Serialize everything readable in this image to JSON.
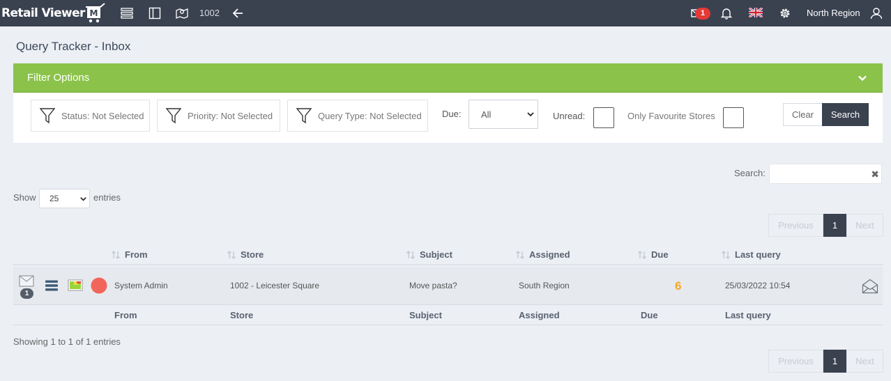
{
  "topbar": {
    "brand": "Retail Viewer",
    "brand_letter": "M",
    "store_id": "1002",
    "notification_count": "1",
    "region": "North Region",
    "icons": [
      "list-icon",
      "sidebar-icon",
      "map-icon",
      "back-arrow-icon",
      "mail-icon",
      "bell-icon",
      "uk-flag-icon",
      "gear-icon",
      "user-icon"
    ]
  },
  "page": {
    "title": "Query Tracker - Inbox"
  },
  "filter": {
    "title": "Filter Options",
    "status": "Status: Not Selected",
    "priority": "Priority: Not Selected",
    "query_type": "Query Type: Not Selected",
    "due_label": "Due:",
    "due_value": "All",
    "unread_label": "Unread:",
    "fav_label": "Only Favourite Stores",
    "clear": "Clear",
    "search": "Search"
  },
  "table_controls": {
    "search_label": "Search:",
    "show_label": "Show",
    "page_length": "25",
    "entries_label": "entries",
    "info": "Showing 1 to 1 of 1 entries"
  },
  "pagination": {
    "previous": "Previous",
    "page": "1",
    "next": "Next"
  },
  "table": {
    "columns": [
      "From",
      "Store",
      "Subject",
      "Assigned",
      "Due",
      "Last query"
    ],
    "rows": [
      {
        "message_count": "1",
        "from": "System Admin",
        "store": "1002 - Leicester Square",
        "subject": "Move pasta?",
        "assigned": "South Region",
        "due": "6",
        "last_query": "25/03/2022 10:54"
      }
    ]
  },
  "colors": {
    "header": "#3a4250",
    "filter_green": "#8bc34a",
    "due_orange": "#f5a623",
    "priority_red": "#f2655a"
  }
}
